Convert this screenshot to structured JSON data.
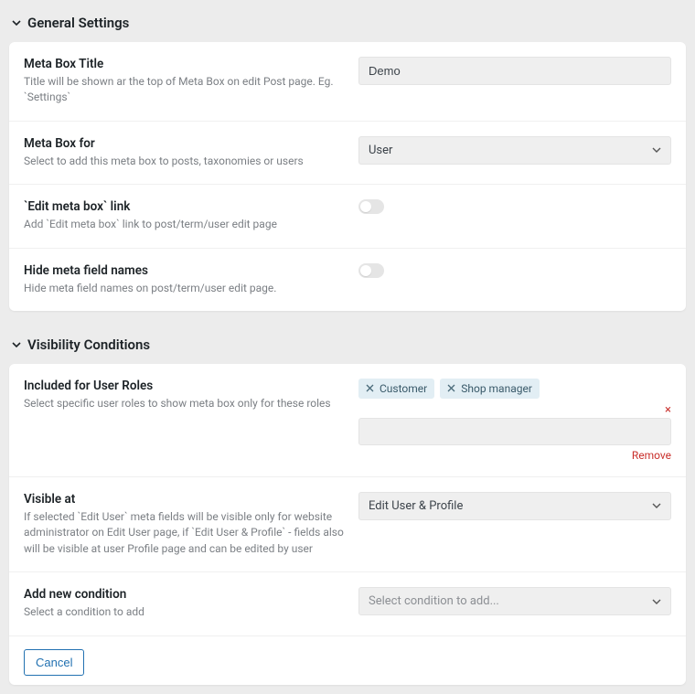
{
  "sections": {
    "general": {
      "title": "General Settings",
      "rows": {
        "title_row": {
          "label": "Meta Box Title",
          "desc": "Title will be shown ar the top of Meta Box on edit Post page. Eg. `Settings`",
          "value": "Demo"
        },
        "for_row": {
          "label": "Meta Box for",
          "desc": "Select to add this meta box to posts, taxonomies or users",
          "value": "User"
        },
        "edit_link_row": {
          "label": "`Edit meta box` link",
          "desc": "Add `Edit meta box` link to post/term/user edit page"
        },
        "hide_names_row": {
          "label": "Hide meta field names",
          "desc": "Hide meta field names on post/term/user edit page."
        }
      }
    },
    "visibility": {
      "title": "Visibility Conditions",
      "rows": {
        "roles_row": {
          "label": "Included for User Roles",
          "desc": "Select specific user roles to show meta box only for these roles",
          "tags": [
            "Customer",
            "Shop manager"
          ],
          "remove_label": "Remove"
        },
        "visible_at_row": {
          "label": "Visible at",
          "desc": "If selected `Edit User` meta fields will be visible only for website administrator on Edit User page, if `Edit User & Profile` - fields also will be visible at user Profile page and can be edited by user",
          "value": "Edit User & Profile"
        },
        "add_condition_row": {
          "label": "Add new condition",
          "desc": "Select a condition to add",
          "placeholder": "Select condition to add..."
        }
      }
    }
  },
  "buttons": {
    "cancel": "Cancel"
  }
}
